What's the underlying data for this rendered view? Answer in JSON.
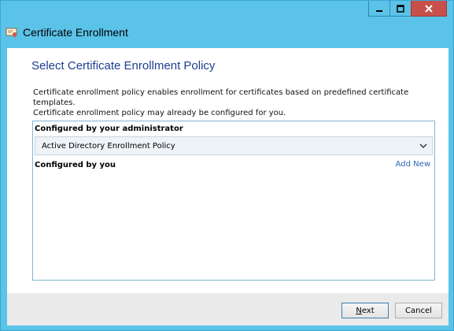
{
  "window": {
    "title": "Certificate Enrollment",
    "title_icon": "certificate-icon",
    "caption_buttons": [
      "minimize-icon",
      "maximize-icon",
      "close-icon"
    ]
  },
  "page": {
    "heading": "Select Certificate Enrollment Policy",
    "description_line1": "Certificate enrollment policy enables enrollment for certificates based on predefined certificate templates.",
    "description_line2": "Certificate enrollment policy may already be configured for you."
  },
  "policies": {
    "admin_label": "Configured by your administrator",
    "selected_policy": "Active Directory Enrollment Policy",
    "you_label": "Configured by you",
    "add_new_link": "Add New"
  },
  "footer": {
    "next_label_first": "N",
    "next_label_rest": "ext",
    "cancel_label": "Cancel"
  },
  "colors": {
    "frame": "#5bc3e8",
    "heading": "#1e3e90",
    "link": "#2a66b5",
    "close_button": "#c7504b"
  }
}
